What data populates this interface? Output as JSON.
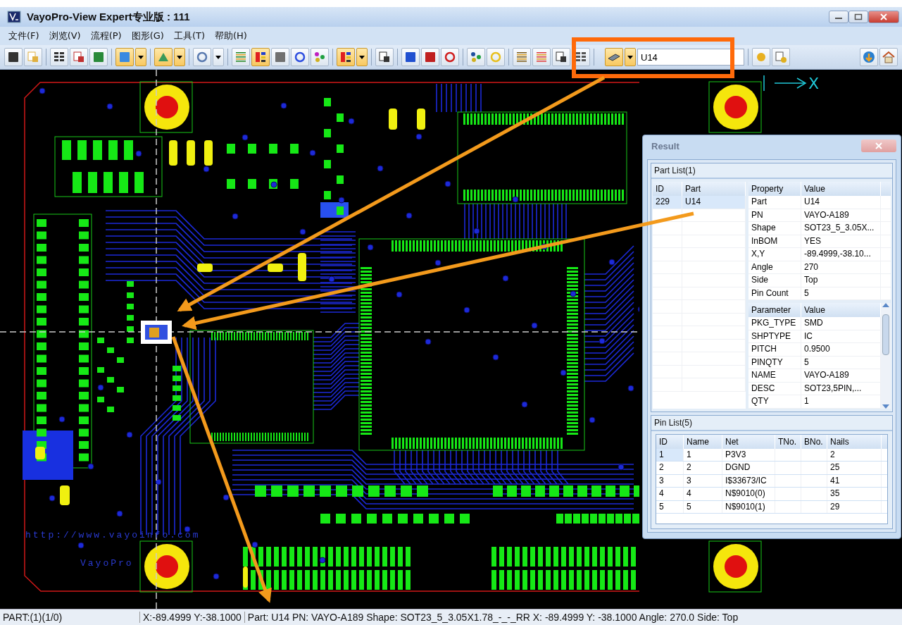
{
  "window": {
    "title": "VayoPro-View Expert专业版 : 111"
  },
  "menu": [
    "文件(F)",
    "浏览(V)",
    "流程(P)",
    "图形(G)",
    "工具(T)",
    "帮助(H)"
  ],
  "toolbar": {
    "search_value": "U14"
  },
  "canvas": {
    "axis_label": "X",
    "board_url": "http://www.vayoinfo.com",
    "board_brand": "VayoPro"
  },
  "result": {
    "title": "Result",
    "part_list": {
      "title": "Part List(1)",
      "columns": [
        "ID",
        "Part"
      ],
      "rows": [
        {
          "id": "229",
          "part": "U14",
          "selected": true
        }
      ]
    },
    "properties": {
      "columns": [
        "Property",
        "Value"
      ],
      "rows": [
        [
          "Part",
          "U14"
        ],
        [
          "PN",
          "VAYO-A189"
        ],
        [
          "Shape",
          "SOT23_5_3.05X..."
        ],
        [
          "InBOM",
          "YES"
        ],
        [
          "X,Y",
          "-89.4999,-38.10..."
        ],
        [
          "Angle",
          "270"
        ],
        [
          "Side",
          "Top"
        ],
        [
          "Pin Count",
          "5"
        ]
      ]
    },
    "parameters": {
      "columns": [
        "Parameter",
        "Value"
      ],
      "rows": [
        [
          "PKG_TYPE",
          "SMD"
        ],
        [
          "SHPTYPE",
          "IC"
        ],
        [
          "PITCH",
          "0.9500"
        ],
        [
          "PINQTY",
          "5"
        ],
        [
          "NAME",
          "VAYO-A189"
        ],
        [
          "DESC",
          "SOT23,5PIN,..."
        ],
        [
          "QTY",
          "1"
        ]
      ]
    },
    "pin_list": {
      "title": "Pin List(5)",
      "columns": [
        "ID",
        "Name",
        "Net",
        "TNo.",
        "BNo.",
        "Nails"
      ],
      "rows": [
        {
          "cells": [
            "1",
            "1",
            "P3V3",
            "",
            "",
            "2"
          ],
          "selected": true
        },
        {
          "cells": [
            "2",
            "2",
            "DGND",
            "",
            "",
            "25"
          ],
          "selected": false
        },
        {
          "cells": [
            "3",
            "3",
            "I$33673/IC",
            "",
            "",
            "41"
          ],
          "selected": false
        },
        {
          "cells": [
            "4",
            "4",
            "N$9010(0)",
            "",
            "",
            "35"
          ],
          "selected": false
        },
        {
          "cells": [
            "5",
            "5",
            "N$9010(1)",
            "",
            "",
            "29"
          ],
          "selected": false
        }
      ]
    }
  },
  "status_bar": [
    "PART:(1)(1/0)",
    "X:-89.4999 Y:-38.1000",
    "Part: U14 PN: VAYO-A189 Shape: SOT23_5_3.05X1.78_-_-_RR X: -89.4999 Y: -38.1000 Angle: 270.0 Side: Top"
  ]
}
